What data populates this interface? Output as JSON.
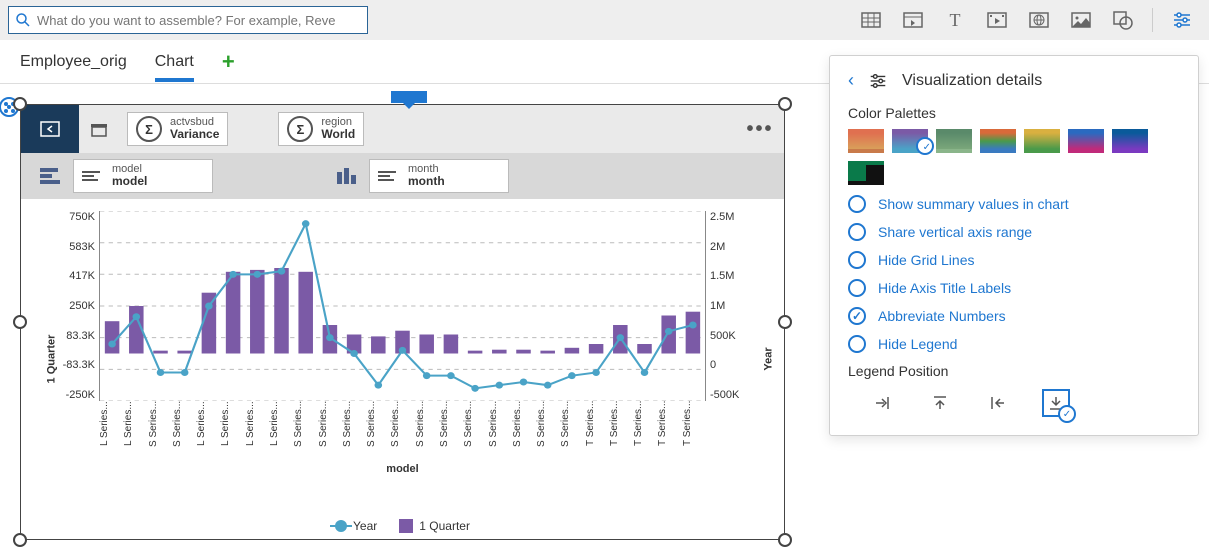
{
  "search": {
    "placeholder": "What do you want to assemble? For example, Reve"
  },
  "tabs": {
    "tab0": "Employee_orig",
    "tab1": "Chart"
  },
  "widget": {
    "chip1": {
      "top": "actvsbud",
      "bottom": "Variance"
    },
    "chip2": {
      "top": "region",
      "bottom": "World"
    },
    "chip3": {
      "top": "model",
      "bottom": "model"
    },
    "chip4": {
      "top": "month",
      "bottom": "month"
    },
    "axis_left": "1 Quarter",
    "axis_right": "Year",
    "axis_bottom": "model",
    "legend": {
      "s0": "Year",
      "s1": "1 Quarter"
    },
    "yticks_left": [
      "750K",
      "583K",
      "417K",
      "250K",
      "83.3K",
      "-83.3K",
      "-250K"
    ],
    "yticks_right": [
      "2.5M",
      "2M",
      "1.5M",
      "1M",
      "500K",
      "0",
      "-500K"
    ]
  },
  "panel": {
    "title": "Visualization details",
    "section_palettes": "Color Palettes",
    "opt0": "Show summary values in chart",
    "opt1": "Share vertical axis range",
    "opt2": "Hide Grid Lines",
    "opt3": "Hide Axis Title Labels",
    "opt4": "Abbreviate Numbers",
    "opt5": "Hide Legend",
    "section_legend": "Legend Position"
  },
  "chart_data": {
    "type": "bar+line",
    "xlabel": "model",
    "categories": [
      "L Series...",
      "L Series...",
      "S Series...",
      "S Series...",
      "L Series...",
      "L Series...",
      "L Series...",
      "L Series...",
      "S Series...",
      "S Series...",
      "S Series...",
      "S Series...",
      "S Series...",
      "S Series...",
      "S Series...",
      "S Series...",
      "S Series...",
      "S Series...",
      "S Series...",
      "S Series...",
      "T Series...",
      "T Series...",
      "T Series...",
      "T Series...",
      "T Series..."
    ],
    "series": [
      {
        "name": "1 Quarter",
        "type": "bar",
        "axis": "left",
        "ylabel": "1 Quarter",
        "ylim": [
          -250000,
          750000
        ],
        "yticks": [
          750000,
          583000,
          417000,
          250000,
          83300,
          -83300,
          -250000
        ],
        "values": [
          170000,
          250000,
          15000,
          15000,
          320000,
          430000,
          440000,
          450000,
          430000,
          150000,
          100000,
          90000,
          120000,
          100000,
          100000,
          15000,
          20000,
          20000,
          15000,
          30000,
          50000,
          150000,
          50000,
          200000,
          220000
        ]
      },
      {
        "name": "Year",
        "type": "line",
        "axis": "right",
        "ylabel": "Year",
        "ylim": [
          -500000,
          2500000
        ],
        "yticks": [
          2500000,
          2000000,
          1500000,
          1000000,
          500000,
          0,
          -500000
        ],
        "values": [
          400000,
          830000,
          -50000,
          -50000,
          1000000,
          1500000,
          1500000,
          1550000,
          2300000,
          500000,
          250000,
          -250000,
          300000,
          -100000,
          -100000,
          -300000,
          -250000,
          -200000,
          -250000,
          -100000,
          -50000,
          500000,
          -50000,
          600000,
          700000
        ]
      }
    ]
  }
}
